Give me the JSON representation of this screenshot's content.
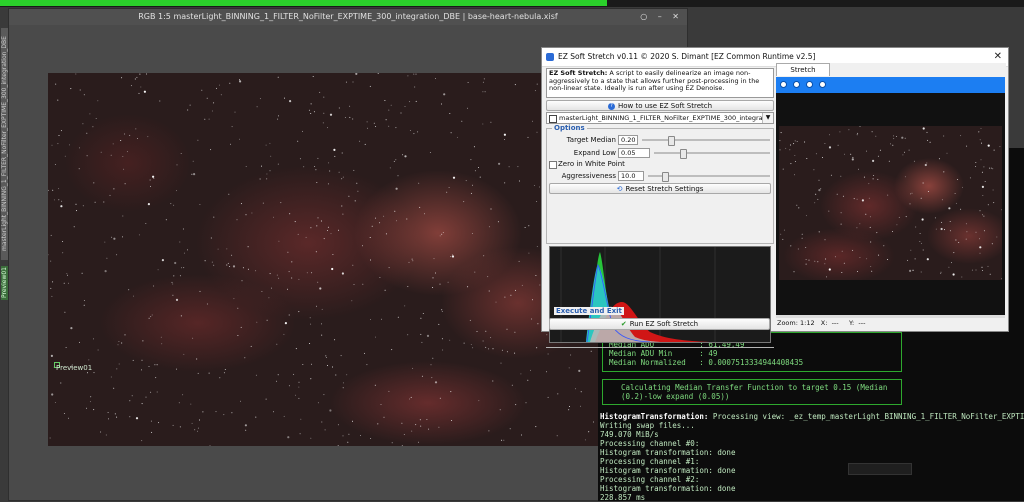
{
  "image_window": {
    "title": "RGB 1:5 masterLight_BINNING_1_FILTER_NoFilter_EXPTIME_300_integration_DBE | base-heart-nebula.xisf",
    "controls": "○ – ✕",
    "side_tabs": [
      "masterLight_BINNING_1_FILTER_NoFilter_EXPTIME_300_integration_DBE",
      "Preview01"
    ],
    "preview_label": "Preview01"
  },
  "dialog": {
    "title": "EZ Soft Stretch v0.11 © 2020 S. Dimant [EZ Common Runtime v2.5]",
    "close": "✕",
    "description_bold": "EZ Soft Stretch:",
    "description": " A script to easily delinearize an image non-aggressively to a state that allows further post-processing in the non-linear state. Ideally is run after using EZ Denoise.",
    "how_to_button": "How to use EZ Soft Stretch",
    "view_selector": "masterLight_BINNING_1_FILTER_NoFilter_EXPTIME_300_integratio",
    "options_label": "Options",
    "target_median_label": "Target Median",
    "target_median_value": "0.20",
    "expand_low_label": "Expand Low",
    "expand_low_value": "0.05",
    "zero_white_label": "Zero in White Point",
    "aggressiveness_label": "Aggressiveness",
    "aggressiveness_value": "10.0",
    "reset_button": "Reset Stretch Settings",
    "execute_label": "Execute and Exit",
    "run_button": "Run EZ Soft Stretch"
  },
  "preview_panel": {
    "tab": "Stretch Preview",
    "zoom_label": "Zoom: 1:12",
    "x_label": "X:  ---",
    "y_label": "Y:  ---"
  },
  "console": {
    "stats": [
      "Median ADU          : 61,49,49",
      "Median ADU Min      : 49",
      "Median Normalized   : 0.0007513334944408435"
    ],
    "calc_message": "Calculating Median Transfer Function to target 0.15 (Median (0.2)-low expand (0.05))",
    "ht_prefix": "HistogramTransformation:",
    "ht_rest": " Processing view: _ez_temp_masterLight_BINNING_1_FILTER_NoFilter_EXPTIME_300_i",
    "lines": [
      "Writing swap files...",
      "749.070 MiB/s",
      "Processing channel #0:",
      "Histogram transformation: done",
      "Processing channel #1:",
      "Histogram transformation: done",
      "Processing channel #2:",
      "Histogram transformation: done",
      "228.857 ms"
    ]
  }
}
